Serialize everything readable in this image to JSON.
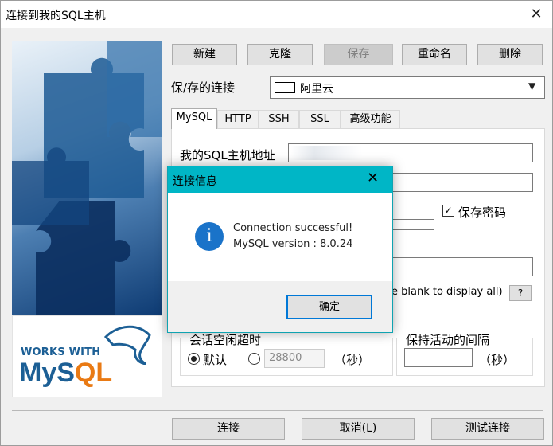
{
  "window": {
    "title": "连接到我的SQL主机",
    "close_glyph": "✕"
  },
  "toolbar": {
    "new": "新建",
    "clone": "克隆",
    "save": "保存",
    "rename": "重命名",
    "delete": "删除"
  },
  "saved_connections": {
    "label": "保/存的连接",
    "value": "阿里云"
  },
  "tabs": [
    "MySQL",
    "HTTP",
    "SSH",
    "SSL",
    "高级功能"
  ],
  "mysql_tab": {
    "host_label": "我的SQL主机地址",
    "save_password_label": "保存密码",
    "partial_hint": "e blank to display all)",
    "help_label": "?"
  },
  "session_timeout": {
    "title": "会话空闲超时",
    "default_label": "默认",
    "value": "28800",
    "unit": "（秒）"
  },
  "keepalive": {
    "title": "保持活动的间隔",
    "unit": "（秒）"
  },
  "logo": {
    "works_with": "WORKS WITH",
    "brand_a": "MyS",
    "brand_b": "QL"
  },
  "dialog": {
    "title": "连接信息",
    "line1": "Connection successful!",
    "line2": "MySQL version : 8.0.24",
    "ok": "确定",
    "icon_glyph": "i",
    "close_glyph": "✕"
  },
  "footer": {
    "connect": "连接",
    "cancel": "取消(L)",
    "test": "测试连接"
  },
  "colors": {
    "dialog_title": "#00b6c6",
    "info_icon": "#1a73c9",
    "mysql_blue": "#1c5f95",
    "mysql_orange": "#e97a14"
  }
}
